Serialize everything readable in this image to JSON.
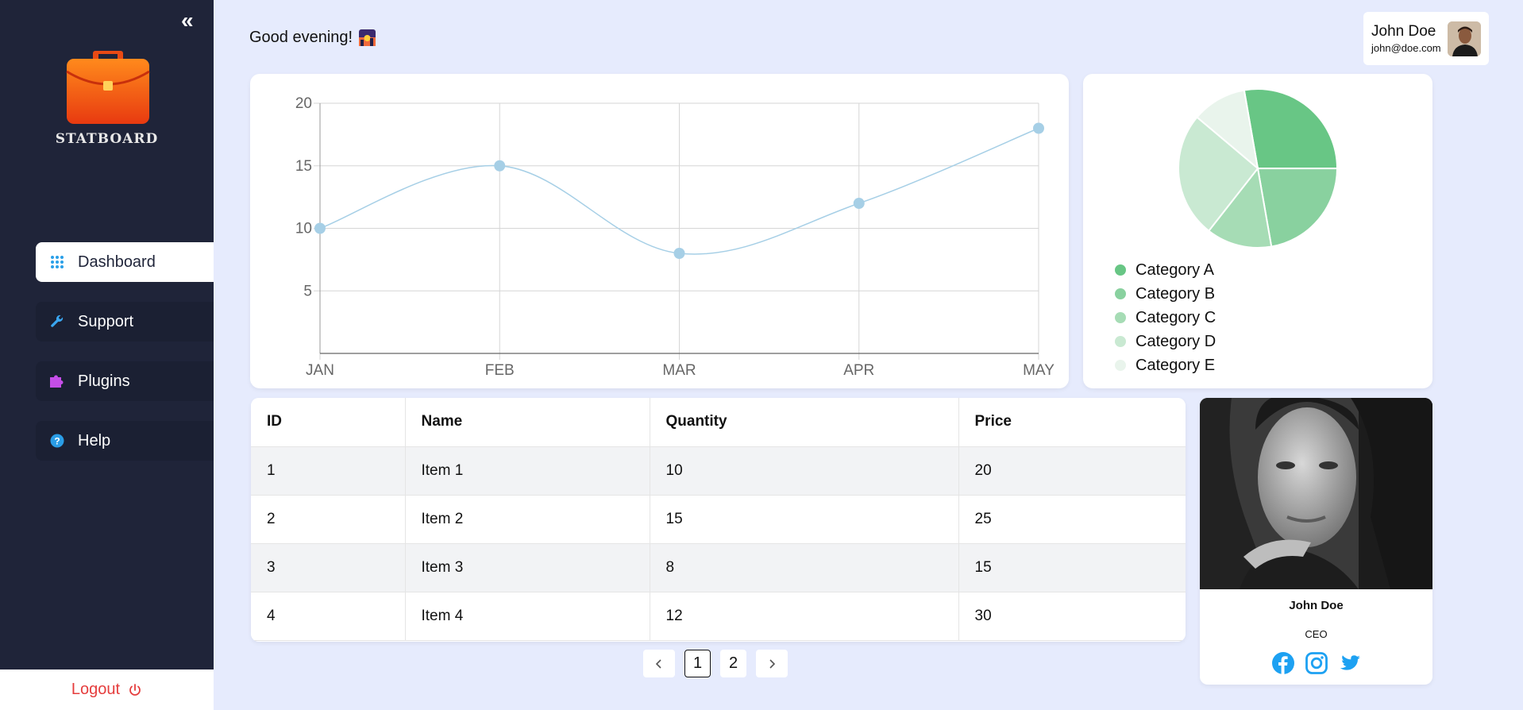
{
  "app": {
    "name": "STATBOARD"
  },
  "sidebar": {
    "collapse_glyph": "«",
    "items": [
      {
        "label": "Dashboard",
        "icon": "grid-icon",
        "active": true
      },
      {
        "label": "Support",
        "icon": "wrench-icon",
        "active": false
      },
      {
        "label": "Plugins",
        "icon": "puzzle-icon",
        "active": false
      },
      {
        "label": "Help",
        "icon": "help-icon",
        "active": false
      }
    ],
    "logout_label": "Logout"
  },
  "header": {
    "greeting": "Good evening!",
    "user": {
      "name": "John Doe",
      "email": "john@doe.com"
    }
  },
  "colors": {
    "sidebar_bg": "#1f2439",
    "page_bg": "#e6ebfd",
    "line": "#a6cfe6",
    "logout": "#e53d3d",
    "social_blue": "#1da1f2"
  },
  "chart_data": [
    {
      "type": "line",
      "x": [
        "JAN",
        "FEB",
        "MAR",
        "APR",
        "MAY"
      ],
      "values": [
        10,
        15,
        8,
        12,
        18
      ],
      "ylim": [
        0,
        20
      ],
      "yticks": [
        5,
        10,
        15,
        20
      ],
      "grid": true,
      "color": "#a6cfe6"
    },
    {
      "type": "pie",
      "categories": [
        "Category A",
        "Category B",
        "Category C",
        "Category D",
        "Category E"
      ],
      "values": [
        25,
        20,
        12,
        23,
        10
      ],
      "colors": [
        "#68c685",
        "#89d19f",
        "#a6dcb5",
        "#c9e9d2",
        "#e9f4ec"
      ],
      "legend": "bottom-left"
    }
  ],
  "table": {
    "columns": [
      "ID",
      "Name",
      "Quantity",
      "Price"
    ],
    "rows": [
      [
        "1",
        "Item 1",
        "10",
        "20"
      ],
      [
        "2",
        "Item 2",
        "15",
        "25"
      ],
      [
        "3",
        "Item 3",
        "8",
        "15"
      ],
      [
        "4",
        "Item 4",
        "12",
        "30"
      ]
    ]
  },
  "pagination": {
    "pages": [
      "1",
      "2"
    ],
    "current": "1",
    "prev": "‹",
    "next": "›"
  },
  "profile": {
    "name": "John Doe",
    "role": "CEO",
    "socials": [
      "facebook-icon",
      "instagram-icon",
      "twitter-icon"
    ]
  }
}
